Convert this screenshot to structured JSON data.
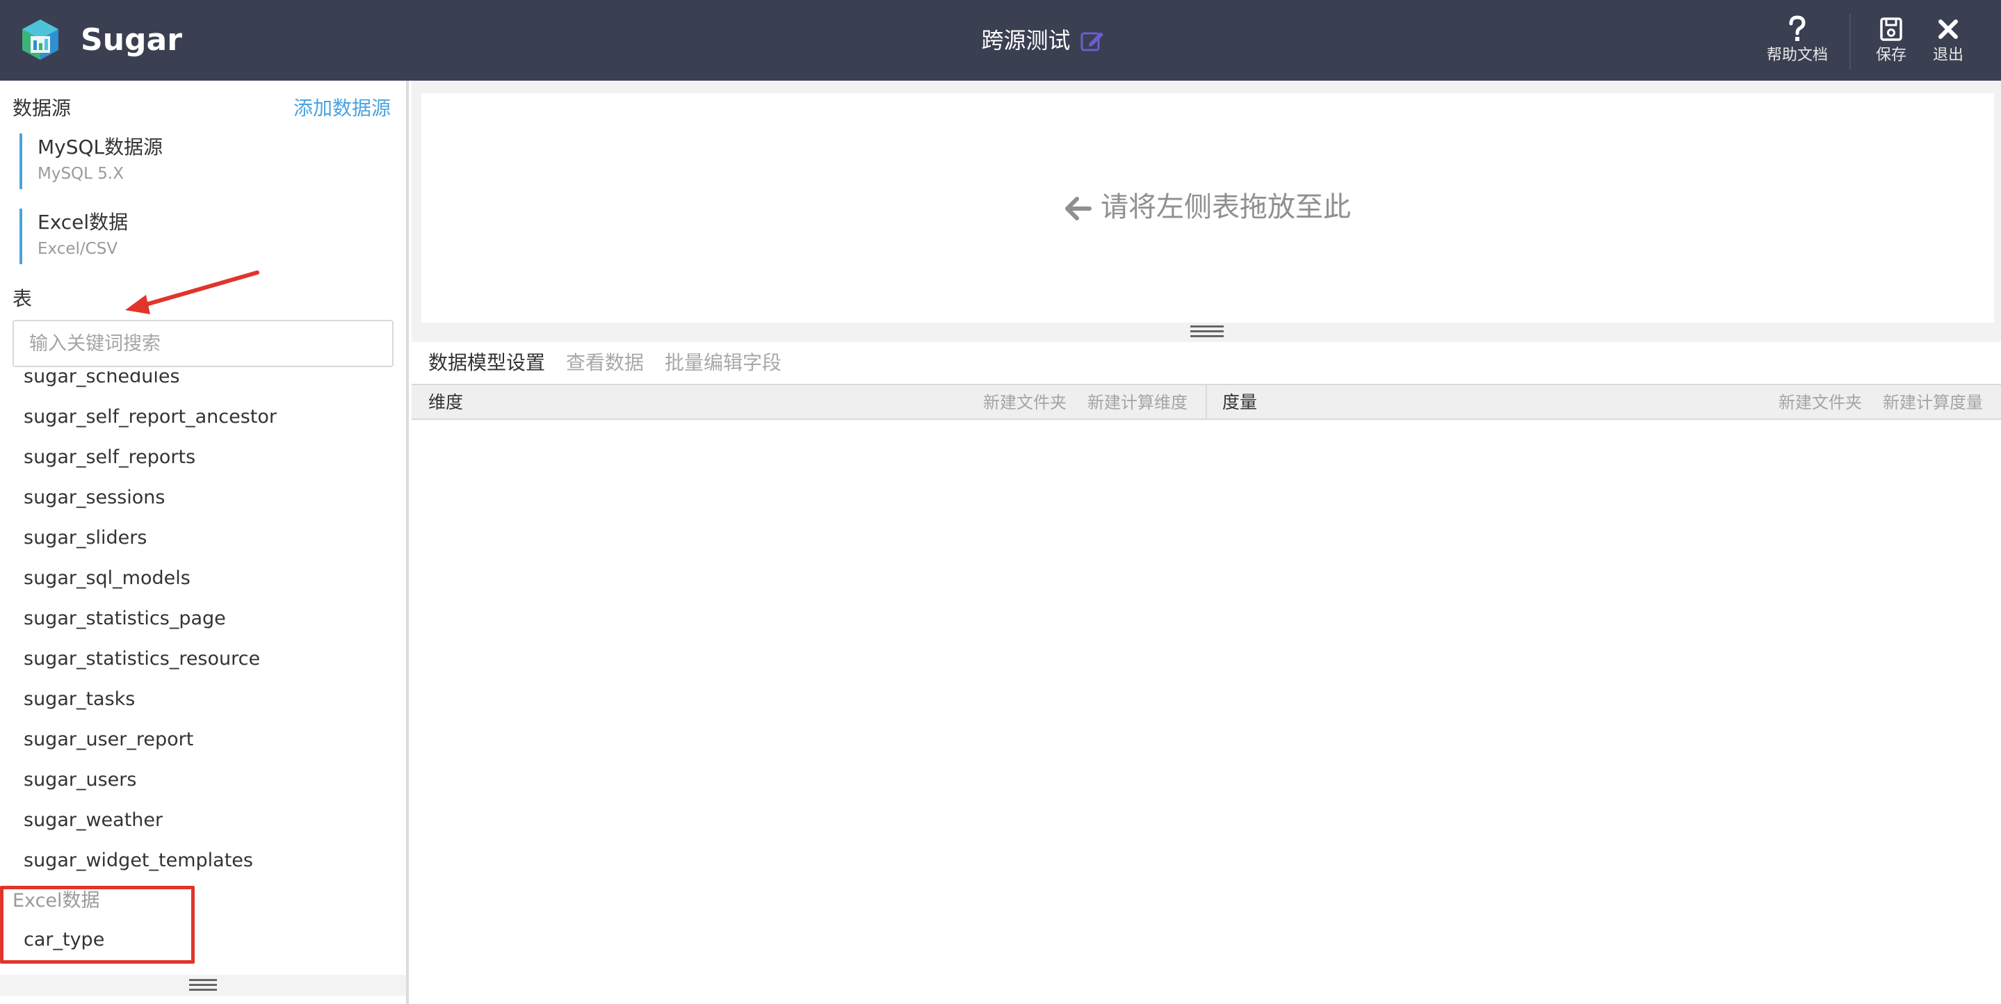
{
  "header": {
    "app_name": "Sugar",
    "page_title": "跨源测试",
    "help_label": "帮助文档",
    "save_label": "保存",
    "exit_label": "退出",
    "bg_color": "#3a3f51",
    "edit_icon_color": "#6c5ecf"
  },
  "sidebar": {
    "datasource_title": "数据源",
    "add_datasource": "添加数据源",
    "datasources": [
      {
        "name": "MySQL数据源",
        "type": "MySQL 5.X"
      },
      {
        "name": "Excel数据",
        "type": "Excel/CSV"
      }
    ],
    "table_title": "表",
    "search_placeholder": "输入关键词搜索",
    "tables": [
      "sugar_schedules",
      "sugar_self_report_ancestor",
      "sugar_self_reports",
      "sugar_sessions",
      "sugar_sliders",
      "sugar_sql_models",
      "sugar_statistics_page",
      "sugar_statistics_resource",
      "sugar_tasks",
      "sugar_user_report",
      "sugar_users",
      "sugar_weather",
      "sugar_widget_templates"
    ],
    "excel_group_label": "Excel数据",
    "excel_tables": [
      "car_type"
    ],
    "accent_color": "#4aa3df",
    "annotation_color": "#e0352b"
  },
  "main": {
    "drop_hint": "请将左侧表拖放至此",
    "tabs": [
      {
        "label": "数据模型设置",
        "active": true
      },
      {
        "label": "查看数据",
        "active": false
      },
      {
        "label": "批量编辑字段",
        "active": false
      }
    ],
    "dimension": {
      "title": "维度",
      "new_folder": "新建文件夹",
      "new_calc": "新建计算维度"
    },
    "measure": {
      "title": "度量",
      "new_folder": "新建文件夹",
      "new_calc": "新建计算度量"
    }
  }
}
